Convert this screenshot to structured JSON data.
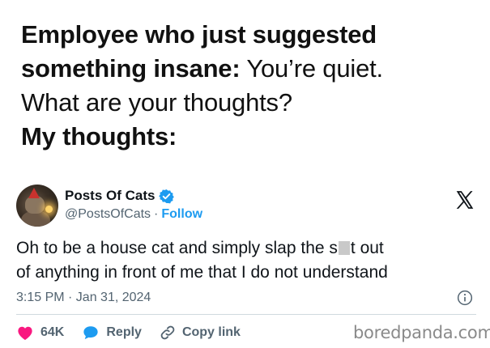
{
  "caption": {
    "line1_bold": "Employee who just suggested",
    "line2_bold": "something insane:",
    "line2_regular": " You’re quiet.",
    "line3_regular": "What are your thoughts?",
    "line4_bold": "My thoughts:"
  },
  "tweet": {
    "display_name": "Posts Of Cats",
    "handle": "@PostsOfCats",
    "separator": "·",
    "follow_label": "Follow",
    "text_before_censor": "Oh to be a house cat and simply slap the s",
    "text_after_censor": "t out",
    "text_line2": "of anything in front of me that I do not understand",
    "timestamp": "3:15 PM · Jan 31, 2024",
    "likes_count": "64K",
    "reply_label": "Reply",
    "copy_link_label": "Copy link"
  },
  "watermark": "boredpanda.com",
  "icons": {
    "verified": "verified-badge-icon",
    "x_logo": "x-logo-icon",
    "info": "info-icon",
    "heart": "heart-icon",
    "reply": "reply-bubble-icon",
    "link": "link-icon"
  },
  "colors": {
    "text_primary": "#0f1419",
    "text_secondary": "#536471",
    "accent_blue": "#1d9bf0",
    "heart_pink": "#f91880",
    "divider": "#cfd9de"
  }
}
